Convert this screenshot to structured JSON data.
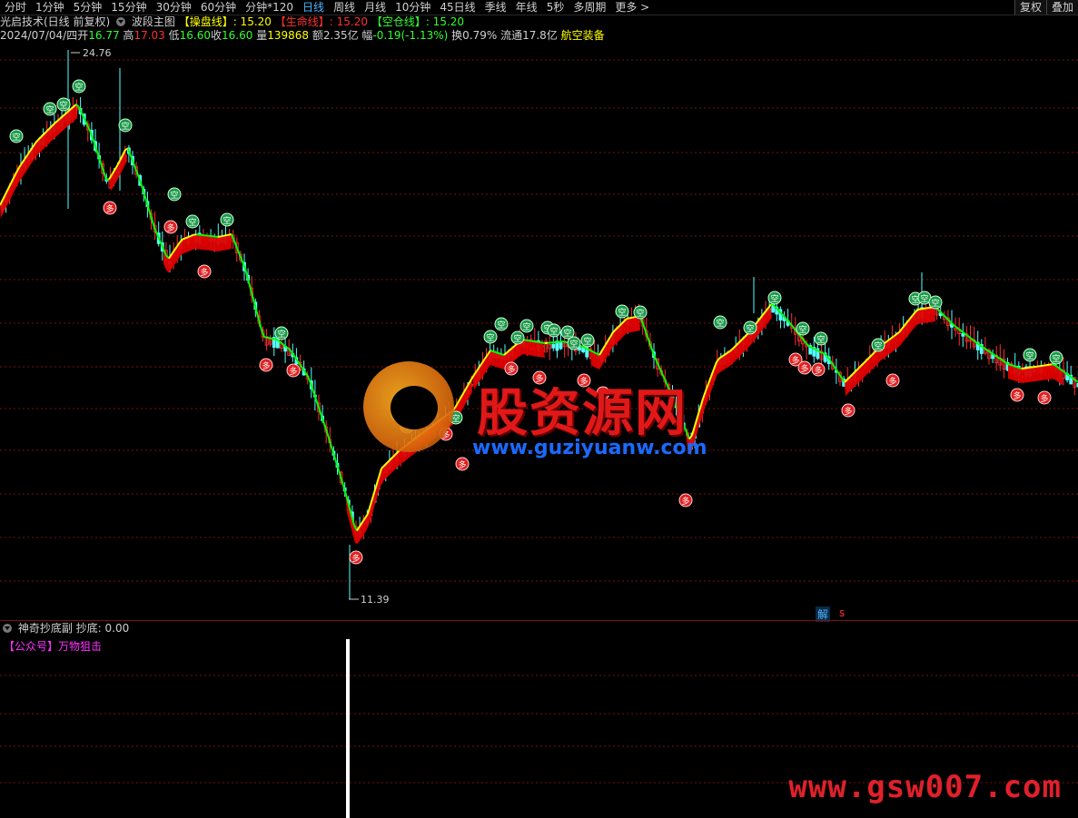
{
  "toolbar": {
    "tabs": [
      "分时",
      "1分钟",
      "5分钟",
      "15分钟",
      "30分钟",
      "60分钟",
      "分钟*120",
      "日线",
      "周线",
      "月线",
      "10分钟",
      "45日线",
      "季线",
      "年线",
      "5秒",
      "多周期",
      "更多 >"
    ],
    "active_index": 7,
    "right": [
      "复权",
      "叠加"
    ]
  },
  "header": {
    "title": "光启技术(日线 前复权)",
    "main_chart": "波段主图",
    "line1_label": "【操盘线】",
    "line1_value": ": 15.20",
    "line2_label": "【生命线】",
    "line2_value": ": 15.20",
    "line3_label": "【空仓线】",
    "line3_value": ": 15.20"
  },
  "quote": {
    "date": "2024/07/04/四",
    "open_label": "开",
    "open": "16.77",
    "high_label": "高",
    "high": "17.03",
    "low_label": "低",
    "low": "16.60",
    "close_label": "收",
    "close": "16.60",
    "vol_label": "量",
    "vol": "139868",
    "amount": "额2.35亿",
    "change_label": "幅",
    "change": "-0.19(-1.13%)",
    "turnover": "换0.79%",
    "float": "流通17.8亿",
    "concept": "航空装备"
  },
  "annotations": {
    "max_label": "24.76",
    "min_label": "11.39",
    "jie": "解",
    "s_mark": "s"
  },
  "indicator": {
    "name": "神奇抄底副",
    "value_label": "抄底: 0.00",
    "sub": "【公众号】万物狙击"
  },
  "watermark": {
    "cn": "股资源网",
    "url": "www.guziyuanw.com",
    "corner_url": "www.gsw007.com"
  },
  "signals": {
    "buy_char": "多",
    "sell_char": "空"
  },
  "colors": {
    "up": "#ff3030",
    "down": "#54ffff",
    "line_up": "#ffff00",
    "line_down": "#00ff00",
    "ribbon": "#e00000",
    "grid": "#7a1010"
  }
}
